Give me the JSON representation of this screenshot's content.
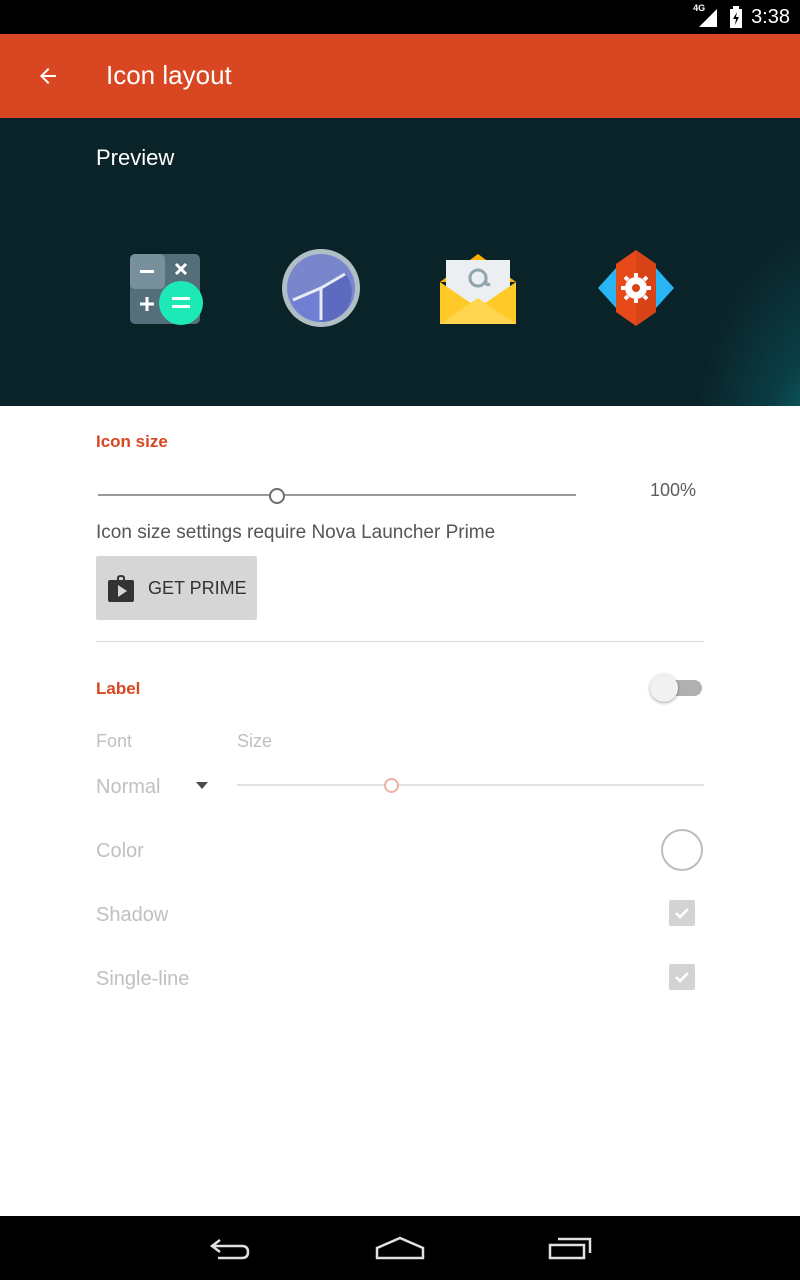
{
  "status_bar": {
    "network": "4G",
    "time": "3:38"
  },
  "app_bar": {
    "title": "Icon layout",
    "back_icon": "arrow-back-icon"
  },
  "preview": {
    "title": "Preview",
    "icons": [
      "calculator-icon",
      "clock-icon",
      "email-icon",
      "nova-settings-icon"
    ]
  },
  "icon_size": {
    "title": "Icon size",
    "value_label": "100%",
    "slider_level": 0.375,
    "info": "Icon size settings require Nova Launcher Prime",
    "button_label": "GET PRIME",
    "button_icon": "store-bag-icon"
  },
  "label": {
    "title": "Label",
    "enabled": false,
    "font_label": "Font",
    "size_label": "Size",
    "font_value": "Normal",
    "size_level": 0.33,
    "color_label": "Color",
    "shadow_label": "Shadow",
    "shadow_checked": true,
    "single_line_label": "Single-line",
    "single_line_checked": true
  },
  "colors": {
    "accent": "#d84722",
    "preview_bg": "#0a2329"
  },
  "nav_bar": {
    "icons": [
      "back-icon",
      "home-icon",
      "recents-icon"
    ]
  }
}
